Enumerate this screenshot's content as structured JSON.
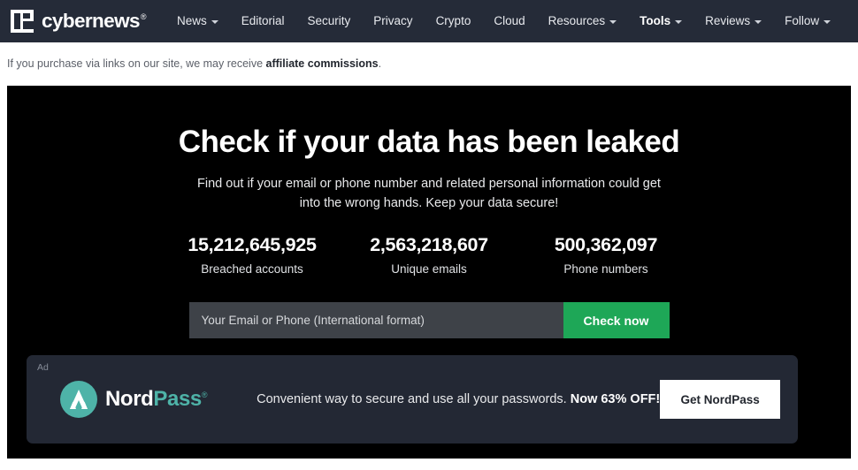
{
  "header": {
    "brand": {
      "name": "cybernews",
      "registered": "®",
      "logo_icon": "cybernews-logo-icon"
    },
    "nav_items": [
      {
        "label": "News",
        "has_dropdown": true,
        "active": false
      },
      {
        "label": "Editorial",
        "has_dropdown": false,
        "active": false
      },
      {
        "label": "Security",
        "has_dropdown": false,
        "active": false
      },
      {
        "label": "Privacy",
        "has_dropdown": false,
        "active": false
      },
      {
        "label": "Crypto",
        "has_dropdown": false,
        "active": false
      },
      {
        "label": "Cloud",
        "has_dropdown": false,
        "active": false
      },
      {
        "label": "Resources",
        "has_dropdown": true,
        "active": false
      },
      {
        "label": "Tools",
        "has_dropdown": true,
        "active": true
      },
      {
        "label": "Reviews",
        "has_dropdown": true,
        "active": false
      }
    ],
    "follow": {
      "label": "Follow",
      "has_dropdown": true
    },
    "search_icon": "search-icon",
    "background_color": "#252b38"
  },
  "affiliate_notice": {
    "text_before": "If you purchase via links on our site, we may receive ",
    "text_bold": "affiliate commissions",
    "text_after": "."
  },
  "hero": {
    "title": "Check if your data has been leaked",
    "subtitle_line1": "Find out if your email or phone number and related personal information could get",
    "subtitle_line2": "into the wrong hands. Keep your data secure!",
    "background_color": "#000000",
    "stats": [
      {
        "value": "15,212,645,925",
        "label": "Breached accounts"
      },
      {
        "value": "2,563,218,607",
        "label": "Unique emails"
      },
      {
        "value": "500,362,097",
        "label": "Phone numbers"
      }
    ],
    "form": {
      "input_placeholder": "Your Email or Phone (International format)",
      "input_value": "",
      "submit_label": "Check now",
      "submit_color": "#1ea757"
    }
  },
  "ad": {
    "tag": "Ad",
    "brand_part1": "Nord",
    "brand_part2": "Pass",
    "brand_registered": "®",
    "logo_icon": "nordpass-mountain-icon",
    "copy_text": "Convenient way to secure and use all your passwords. ",
    "copy_bold": "Now 63% OFF!",
    "cta_label": "Get NordPass",
    "accent_color": "#4eb3a8",
    "background_color": "#232834"
  }
}
